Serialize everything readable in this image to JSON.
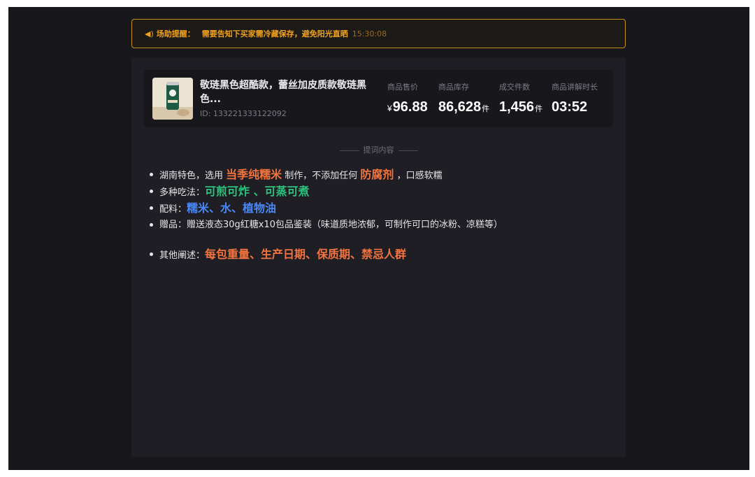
{
  "alert": {
    "label": "场助提醒：",
    "message": "需要告知下买家需冷藏保存，避免阳光直晒",
    "time": "15:30:08"
  },
  "product": {
    "name": "敬琏黑色超酷款，蕾丝加皮质款敬琏黑色...",
    "id": "ID: 133221333122092",
    "stats": [
      {
        "label": "商品售价",
        "prefix": "¥",
        "value": "96.88",
        "unit": ""
      },
      {
        "label": "商品库存",
        "prefix": "",
        "value": "86,628",
        "unit": "件"
      },
      {
        "label": "成交件数",
        "prefix": "",
        "value": "1,456",
        "unit": "件"
      },
      {
        "label": "商品讲解时长",
        "prefix": "",
        "value": "03:52",
        "unit": ""
      }
    ]
  },
  "script": {
    "title": "提词内容",
    "line1": {
      "a": "湖南特色，选用 ",
      "h1": "当季纯糯米",
      "b": " 制作，不添加任何 ",
      "h2": "防腐剂",
      "c": " ，口感软糯"
    },
    "line2": {
      "a": "多种吃法：",
      "h1": "可煎可炸 、可蒸可煮"
    },
    "line3": {
      "a": "配料：",
      "h1": "糯米、水、植物油"
    },
    "line4": {
      "a": "赠品：赠送液态30g红糖x10包品鉴装（味道质地浓郁，可制作可口的冰粉、凉糕等）"
    },
    "line5": {
      "a": "其他阐述：",
      "h1": "每包重量、生产日期、保质期、禁忌人群"
    }
  }
}
